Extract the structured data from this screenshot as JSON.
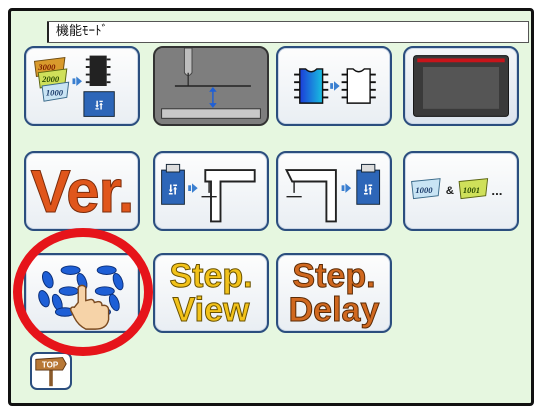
{
  "screen": {
    "title": "機能ﾓｰﾄﾞ"
  },
  "buttons": {
    "pattern_to_usb": {
      "labels": [
        "3000",
        "2000",
        "1000"
      ]
    },
    "version": {
      "label": "Ver."
    },
    "pattern_compare": {
      "label_a": "1000",
      "label_b": "1001",
      "amp": "&",
      "ellipsis": "..."
    },
    "step_view": {
      "line1": "Step.",
      "line2": "View"
    },
    "step_delay": {
      "line1": "Step.",
      "line2": "Delay"
    },
    "top": {
      "label": "TOP"
    }
  },
  "colors": {
    "screen_bg": "#e6f7e0",
    "button_border": "#2b4e7e",
    "highlight": "#e6141a",
    "ver_orange": "#e0561b",
    "step_view_yellow": "#f2c21a",
    "step_delay_orange": "#d0681f",
    "number_blue": "#1e5fd6"
  },
  "icons": [
    "pattern-to-usb-icon",
    "needle-height-icon",
    "memory-copy-icon",
    "panel-display-icon",
    "usb-to-sewing-machine-icon",
    "sewing-machine-to-usb-icon",
    "pattern-compare-icon",
    "number-touch-icon",
    "top-sign-icon"
  ]
}
